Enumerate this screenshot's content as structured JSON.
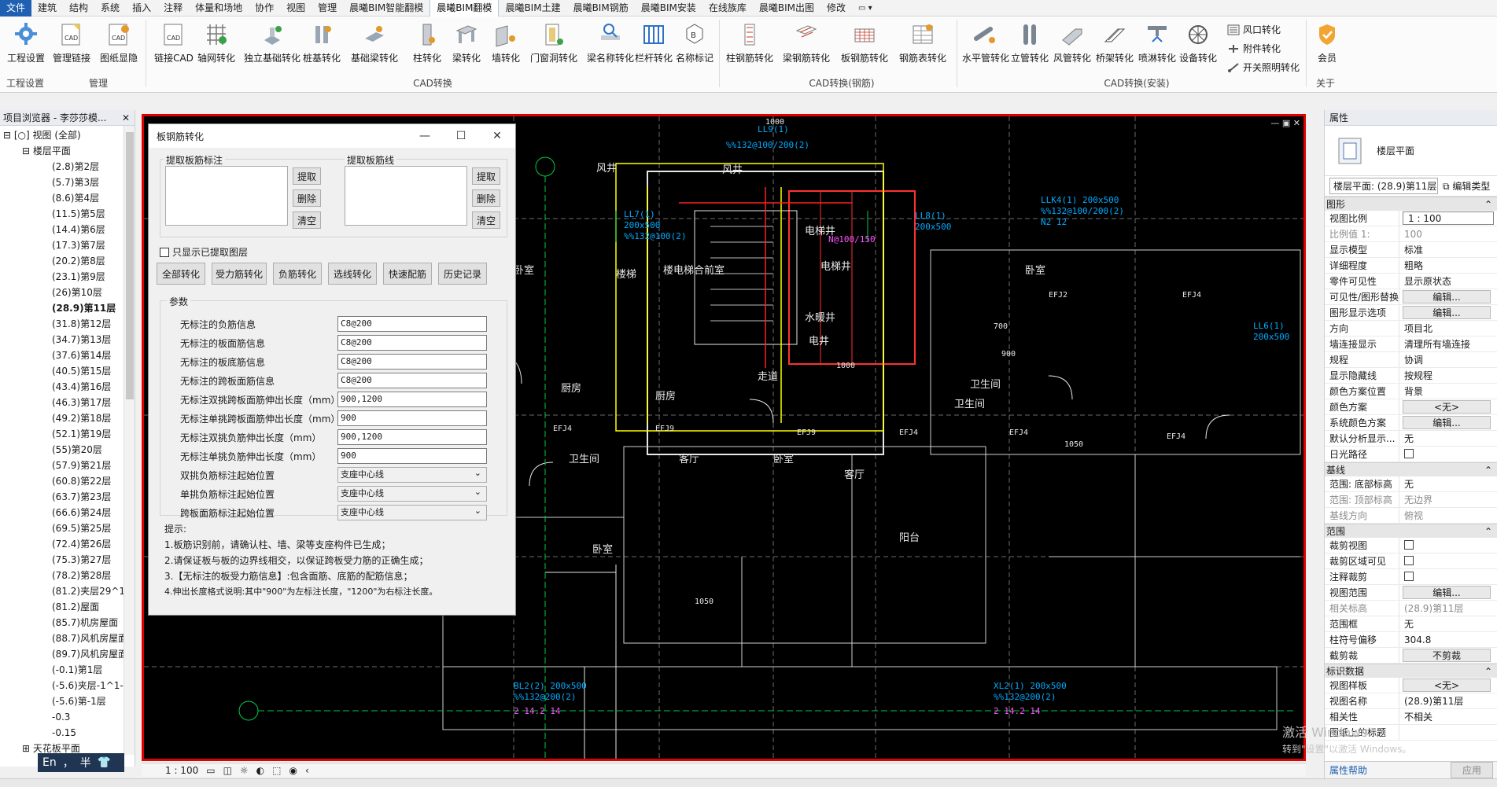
{
  "menu": {
    "file": "文件",
    "items": [
      "建筑",
      "结构",
      "系统",
      "插入",
      "注释",
      "体量和场地",
      "协作",
      "视图",
      "管理",
      "晨曦BIM智能翻模",
      "晨曦BIM翻模",
      "晨曦BIM土建",
      "晨曦BIM钢筋",
      "晨曦BIM安装",
      "在线族库",
      "晨曦BIM出图",
      "修改"
    ],
    "active": "晨曦BIM翻模"
  },
  "ribbon": {
    "buttons": [
      {
        "label": "工程设置",
        "icon": "gear-icon"
      },
      {
        "label": "管理链接",
        "icon": "cad-link-icon"
      },
      {
        "label": "图纸显隐",
        "icon": "cad-toggle-icon"
      },
      {
        "label": "链接CAD",
        "icon": "cad-icon"
      },
      {
        "label": "轴网转化",
        "icon": "grid-icon"
      },
      {
        "label": "独立基础转化",
        "icon": "foundation-icon"
      },
      {
        "label": "桩基转化",
        "icon": "pile-icon"
      },
      {
        "label": "基础梁转化",
        "icon": "foundation-beam-icon"
      },
      {
        "label": "柱转化",
        "icon": "column-icon"
      },
      {
        "label": "梁转化",
        "icon": "beam-icon"
      },
      {
        "label": "墙转化",
        "icon": "wall-icon"
      },
      {
        "label": "门窗洞转化",
        "icon": "door-window-icon"
      },
      {
        "label": "梁名称转化",
        "icon": "beam-name-icon"
      },
      {
        "label": "栏杆转化",
        "icon": "railing-icon"
      },
      {
        "label": "名称标记",
        "icon": "tag-icon"
      },
      {
        "label": "柱钢筋转化",
        "icon": "column-rebar-icon"
      },
      {
        "label": "梁钢筋转化",
        "icon": "beam-rebar-icon"
      },
      {
        "label": "板钢筋转化",
        "icon": "slab-rebar-icon"
      },
      {
        "label": "钢筋表转化",
        "icon": "rebar-table-icon"
      },
      {
        "label": "水平管转化",
        "icon": "horizontal-pipe-icon"
      },
      {
        "label": "立管转化",
        "icon": "vertical-pipe-icon"
      },
      {
        "label": "风管转化",
        "icon": "duct-icon"
      },
      {
        "label": "桥架转化",
        "icon": "cable-tray-icon"
      },
      {
        "label": "喷淋转化",
        "icon": "sprinkler-icon"
      },
      {
        "label": "设备转化",
        "icon": "equipment-icon"
      }
    ],
    "small_buttons": [
      "风口转化",
      "附件转化",
      "开关照明转化"
    ],
    "member": "会员",
    "groups": [
      "工程设置",
      "管理",
      "CAD转换",
      "CAD转换(钢筋)",
      "CAD转换(安装)",
      "关于"
    ]
  },
  "project_browser": {
    "title": "项目浏览器 - 李莎莎模...",
    "root": "视图 (全部)",
    "section": "楼层平面",
    "floors": [
      "(2.8)第2层",
      "(5.7)第3层",
      "(8.6)第4层",
      "(11.5)第5层",
      "(14.4)第6层",
      "(17.3)第7层",
      "(20.2)第8层",
      "(23.1)第9层",
      "(26)第10层",
      "(28.9)第11层",
      "(31.8)第12层",
      "(34.7)第13层",
      "(37.6)第14层",
      "(40.5)第15层",
      "(43.4)第16层",
      "(46.3)第17层",
      "(49.2)第18层",
      "(52.1)第19层",
      "(55)第20层",
      "(57.9)第21层",
      "(60.8)第22层",
      "(63.7)第23层",
      "(66.6)第24层",
      "(69.5)第25层",
      "(72.4)第26层",
      "(75.3)第27层",
      "(78.2)第28层",
      "(81.2)夹层29^1",
      "(81.2)屋面",
      "(85.7)机房屋面",
      "(88.7)风机房屋面",
      "(89.7)风机房屋面",
      "(-0.1)第1层",
      "(-5.6)夹层-1^1-",
      "(-5.6)第-1层",
      "-0.3",
      "-0.15"
    ],
    "selected": "(28.9)第11层",
    "next_section": "天花板平面"
  },
  "dialog": {
    "title": "板钢筋转化",
    "group_mark": "提取板筋标注",
    "group_line": "提取板筋线",
    "btn_extract": "提取",
    "btn_delete": "删除",
    "btn_clear": "清空",
    "show_only": "只显示已提取图层",
    "actions": [
      "全部转化",
      "受力筋转化",
      "负筋转化",
      "选线转化",
      "快速配筋",
      "历史记录"
    ],
    "params_title": "参数",
    "params": [
      {
        "label": "无标注的负筋信息",
        "value": "C8@200",
        "type": "text"
      },
      {
        "label": "无标注的板面筋信息",
        "value": "C8@200",
        "type": "text"
      },
      {
        "label": "无标注的板底筋信息",
        "value": "C8@200",
        "type": "text"
      },
      {
        "label": "无标注的跨板面筋信息",
        "value": "C8@200",
        "type": "text"
      },
      {
        "label": "无标注双挑跨板面筋伸出长度（mm）",
        "value": "900,1200",
        "type": "text"
      },
      {
        "label": "无标注单挑跨板面筋伸出长度（mm）",
        "value": "900",
        "type": "text"
      },
      {
        "label": "无标注双挑负筋伸出长度（mm）",
        "value": "900,1200",
        "type": "text"
      },
      {
        "label": "无标注单挑负筋伸出长度（mm）",
        "value": "900",
        "type": "text"
      },
      {
        "label": "双挑负筋标注起始位置",
        "value": "支座中心线",
        "type": "select"
      },
      {
        "label": "单挑负筋标注起始位置",
        "value": "支座中心线",
        "type": "select"
      },
      {
        "label": "跨板面筋标注起始位置",
        "value": "支座中心线",
        "type": "select"
      }
    ],
    "hint_title": "提示:",
    "hints": [
      "1.板筋识别前，请确认柱、墙、梁等支座构件已生成；",
      "2.请保证板与板的边界线相交，以保证跨板受力筋的正确生成；",
      "3.【无标注的板受力筋信息】:包含面筋、底筋的配筋信息；",
      "4.伸出长度格式说明:其中\"900\"为左标注长度，\"1200\"为右标注长度。"
    ]
  },
  "canvas": {
    "view_tab": "楼层平面: 第11层",
    "labels": [
      "风井",
      "电梯井",
      "楼梯",
      "楼电梯合前室",
      "电梯井",
      "水暖井",
      "电井",
      "走道",
      "厨房",
      "卧室",
      "客厅",
      "卫生间",
      "阳台",
      "厨房",
      "卧室",
      "卫生间",
      "卧室",
      "客厅",
      "卧室",
      "客厅",
      "卫生间",
      "阳台",
      "风井",
      "厨房"
    ],
    "scale": "1 : 100"
  },
  "properties": {
    "title": "属性",
    "type_name": "楼层平面",
    "selector": "楼层平面: (28.9)第11层",
    "edit_type": "编辑类型",
    "sections": [
      {
        "name": "图形",
        "rows": [
          {
            "k": "视图比例",
            "v": "1 : 100",
            "style": "inp"
          },
          {
            "k": "比例值 1:",
            "v": "100",
            "style": "grey"
          },
          {
            "k": "显示模型",
            "v": "标准"
          },
          {
            "k": "详细程度",
            "v": "粗略"
          },
          {
            "k": "零件可见性",
            "v": "显示原状态"
          },
          {
            "k": "可见性/图形替换",
            "v": "编辑...",
            "style": "btn"
          },
          {
            "k": "图形显示选项",
            "v": "编辑...",
            "style": "btn"
          },
          {
            "k": "方向",
            "v": "项目北"
          },
          {
            "k": "墙连接显示",
            "v": "清理所有墙连接"
          },
          {
            "k": "规程",
            "v": "协调"
          },
          {
            "k": "显示隐藏线",
            "v": "按规程"
          },
          {
            "k": "颜色方案位置",
            "v": "背景"
          },
          {
            "k": "颜色方案",
            "v": "<无>",
            "style": "btn"
          },
          {
            "k": "系统颜色方案",
            "v": "编辑...",
            "style": "btn"
          },
          {
            "k": "默认分析显示...",
            "v": "无"
          },
          {
            "k": "日光路径",
            "v": "",
            "style": "cb"
          }
        ]
      },
      {
        "name": "基线",
        "rows": [
          {
            "k": "范围: 底部标高",
            "v": "无"
          },
          {
            "k": "范围: 顶部标高",
            "v": "无边界",
            "style": "grey"
          },
          {
            "k": "基线方向",
            "v": "俯视",
            "style": "grey"
          }
        ]
      },
      {
        "name": "范围",
        "rows": [
          {
            "k": "裁剪视图",
            "v": "",
            "style": "cb"
          },
          {
            "k": "裁剪区域可见",
            "v": "",
            "style": "cb"
          },
          {
            "k": "注释裁剪",
            "v": "",
            "style": "cb"
          },
          {
            "k": "视图范围",
            "v": "编辑...",
            "style": "btn"
          },
          {
            "k": "相关标高",
            "v": "(28.9)第11层",
            "style": "grey"
          },
          {
            "k": "范围框",
            "v": "无"
          },
          {
            "k": "柱符号偏移",
            "v": "304.8"
          },
          {
            "k": "截剪裁",
            "v": "不剪裁",
            "style": "btn"
          }
        ]
      },
      {
        "name": "标识数据",
        "rows": [
          {
            "k": "视图样板",
            "v": "<无>",
            "style": "btn"
          },
          {
            "k": "视图名称",
            "v": "(28.9)第11层"
          },
          {
            "k": "相关性",
            "v": "不相关"
          },
          {
            "k": "图纸上的标题",
            "v": ""
          }
        ]
      }
    ],
    "help": "属性帮助",
    "apply": "应用"
  },
  "ime": {
    "lang": "En",
    "punct": "，",
    "mode": "半"
  },
  "watermark": {
    "line1": "激活 Windows",
    "line2": "转到\"设置\"以激活 Windows。"
  }
}
